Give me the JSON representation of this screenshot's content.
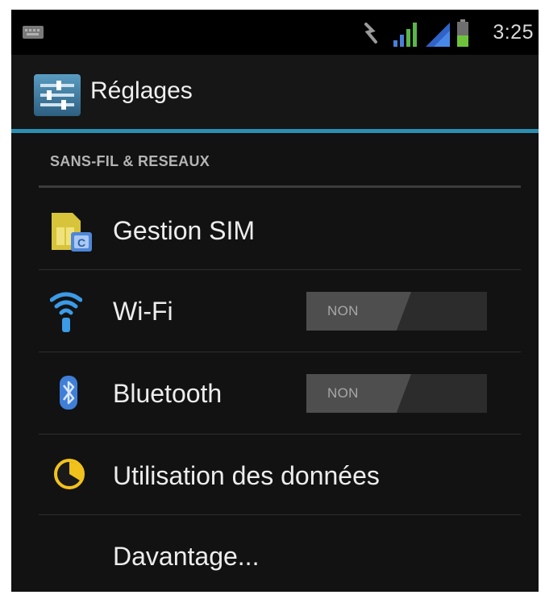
{
  "status_bar": {
    "time": "3:25",
    "icons": [
      "notification-icon",
      "sync-icon",
      "signal-icon",
      "signal-icon",
      "battery-icon"
    ]
  },
  "action_bar": {
    "title": "Réglages",
    "icon": "settings-app-icon"
  },
  "section": {
    "header": "SANS-FIL & RESEAUX"
  },
  "items": [
    {
      "label": "Gestion SIM",
      "icon": "sim-card-icon"
    },
    {
      "label": "Wi-Fi",
      "icon": "wifi-icon",
      "toggle": "NON"
    },
    {
      "label": "Bluetooth",
      "icon": "bluetooth-icon",
      "toggle": "NON"
    },
    {
      "label": "Utilisation des données",
      "icon": "data-usage-icon"
    },
    {
      "label": "Davantage..."
    }
  ],
  "colors": {
    "accent": "#2b8fb2",
    "background": "#121212",
    "text": "#ededed"
  }
}
